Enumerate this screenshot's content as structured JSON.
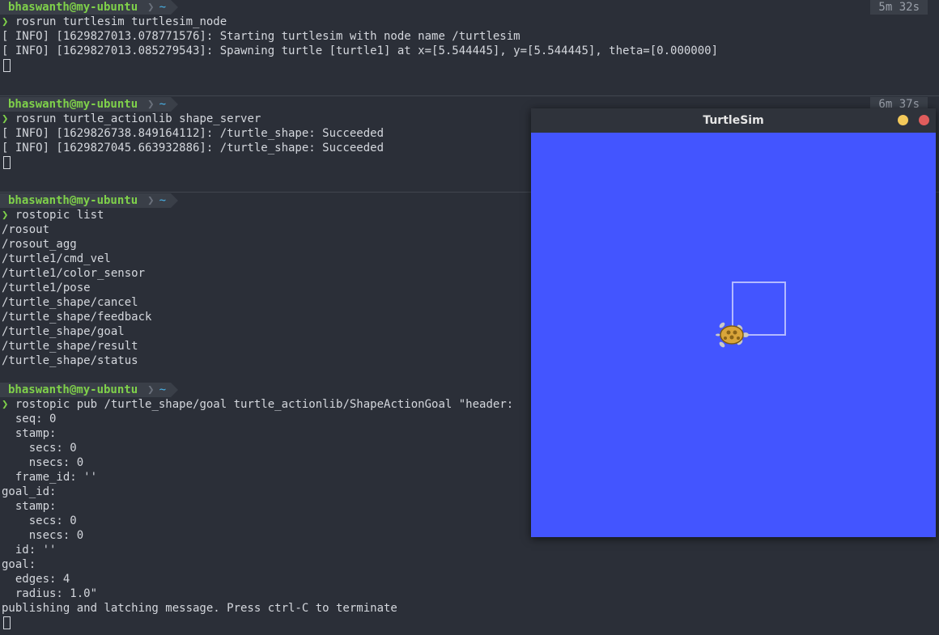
{
  "prompt": {
    "user": "bhaswanth@my-ubuntu",
    "separator": "❯",
    "dir": "~",
    "chevron": "❯"
  },
  "pane1": {
    "timer": "5m 32s",
    "command": "rosrun turtlesim turtlesim_node",
    "output": [
      "[ INFO] [1629827013.078771576]: Starting turtlesim with node name /turtlesim",
      "[ INFO] [1629827013.085279543]: Spawning turtle [turtle1] at x=[5.544445], y=[5.544445], theta=[0.000000]"
    ]
  },
  "pane2": {
    "timer": "6m 37s",
    "command": "rosrun turtle_actionlib shape_server",
    "output": [
      "[ INFO] [1629826738.849164112]: /turtle_shape: Succeeded",
      "[ INFO] [1629827045.663932886]: /turtle_shape: Succeeded"
    ]
  },
  "pane3": {
    "command": "rostopic list",
    "output": [
      "/rosout",
      "/rosout_agg",
      "/turtle1/cmd_vel",
      "/turtle1/color_sensor",
      "/turtle1/pose",
      "/turtle_shape/cancel",
      "/turtle_shape/feedback",
      "/turtle_shape/goal",
      "/turtle_shape/result",
      "/turtle_shape/status"
    ]
  },
  "pane4": {
    "command": "rostopic pub /turtle_shape/goal turtle_actionlib/ShapeActionGoal \"header:",
    "output": [
      "  seq: 0",
      "  stamp:",
      "    secs: 0",
      "    nsecs: 0",
      "  frame_id: ''",
      "goal_id:",
      "  stamp:",
      "    secs: 0",
      "    nsecs: 0",
      "  id: ''",
      "goal:",
      "  edges: 4",
      "  radius: 1.0\"",
      "publishing and latching message. Press ctrl-C to terminate"
    ]
  },
  "turtlesim": {
    "title": "TurtleSim",
    "background_color": "#4355ff",
    "path_color": "#b3b9ff"
  }
}
